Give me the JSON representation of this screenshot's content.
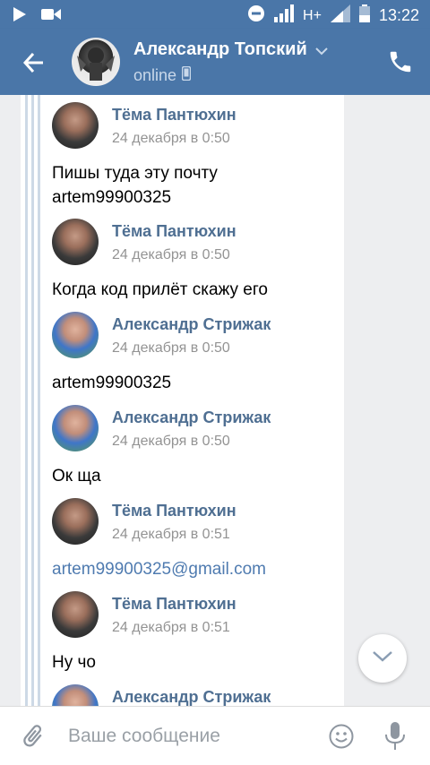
{
  "status_bar": {
    "time": "13:22",
    "network": "H+",
    "icons": [
      "play-icon",
      "video-icon",
      "dnd-icon",
      "signal-icon",
      "signal-icon",
      "battery-icon"
    ]
  },
  "header": {
    "contact_name": "Александр Топский",
    "presence": "online",
    "icons": [
      "back-arrow-icon",
      "chevron-down-icon",
      "mobile-icon",
      "phone-icon"
    ]
  },
  "messages": [
    {
      "author": "Тёма Пантюхин",
      "date": "24 декабря в 0:50",
      "text": "Пишы туда эту почту artem99900325",
      "avatar": "artem"
    },
    {
      "author": "Тёма Пантюхин",
      "date": "24 декабря в 0:50",
      "text": "Когда код прилёт скажу его",
      "avatar": "artem"
    },
    {
      "author": "Александр Стрижак",
      "date": "24 декабря в 0:50",
      "text": "artem99900325",
      "avatar": "strizh"
    },
    {
      "author": "Александр Стрижак",
      "date": "24 декабря в 0:50",
      "text": "Ок ща",
      "avatar": "strizh"
    },
    {
      "author": "Тёма Пантюхин",
      "date": "24 декабря в 0:51",
      "text": "artem99900325@gmail.com",
      "avatar": "artem",
      "is_link": true
    },
    {
      "author": "Тёма Пантюхин",
      "date": "24 декабря в 0:51",
      "text": "Ну чо",
      "avatar": "artem"
    },
    {
      "author": "Александр Стрижак",
      "date": "",
      "text": "",
      "avatar": "strizh"
    }
  ],
  "composer": {
    "placeholder": "Ваше сообщение",
    "value": ""
  },
  "colors": {
    "header_bg": "#4a76a8",
    "author_name": "#4f6f92",
    "link": "#4f7bb0",
    "chat_bg": "#edeef0",
    "forward_line": "#cdd9e6"
  }
}
